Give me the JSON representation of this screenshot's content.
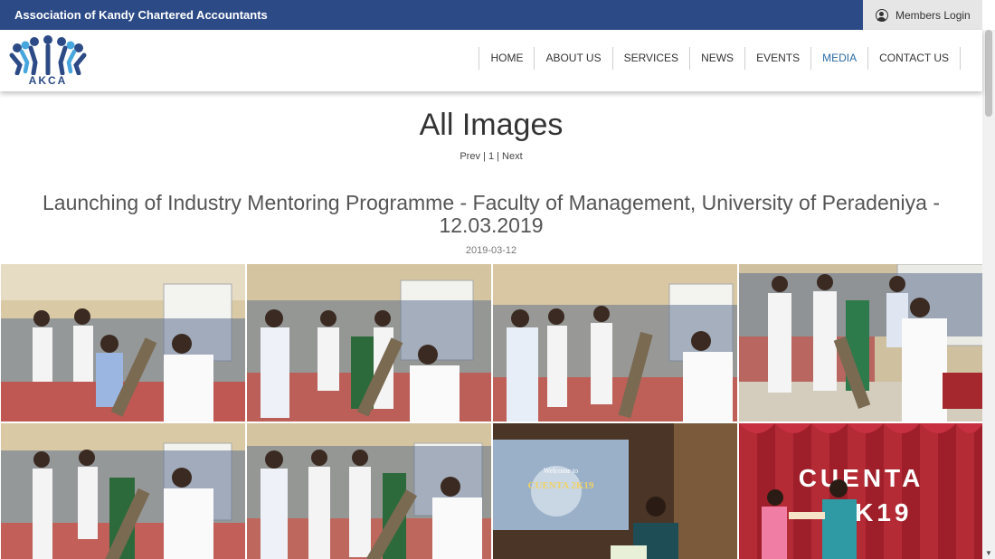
{
  "topbar": {
    "org_name": "Association of Kandy Chartered Accountants",
    "login_label": "Members Login",
    "login_icon": "user-circle-icon"
  },
  "brand": {
    "logo_text": "AKCA",
    "colors": {
      "primary": "#2c4b86",
      "accent": "#2c6aa3"
    }
  },
  "nav": {
    "items": [
      {
        "label": "HOME"
      },
      {
        "label": "ABOUT US"
      },
      {
        "label": "SERVICES"
      },
      {
        "label": "NEWS"
      },
      {
        "label": "EVENTS"
      },
      {
        "label": "MEDIA",
        "active": true
      },
      {
        "label": "CONTACT US"
      }
    ]
  },
  "page": {
    "title": "All Images",
    "pager": {
      "prev": "Prev",
      "page": "1",
      "next": "Next"
    }
  },
  "album": {
    "title": "Launching of Industry Mentoring Programme - Faculty of Management, University of Peradeniya - 12.03.2019",
    "date": "2019-03-12"
  },
  "gallery": {
    "images": [
      {
        "name": "photo-ceremony-1"
      },
      {
        "name": "photo-ceremony-2"
      },
      {
        "name": "photo-ceremony-3"
      },
      {
        "name": "photo-ceremony-4"
      },
      {
        "name": "photo-ceremony-5"
      },
      {
        "name": "photo-ceremony-6"
      },
      {
        "name": "photo-projector-welcome",
        "overlay": "Welcome to\nCUENTA 2K19"
      },
      {
        "name": "photo-cuenta-stage",
        "overlay": "CUENTA\n2K19"
      }
    ]
  }
}
